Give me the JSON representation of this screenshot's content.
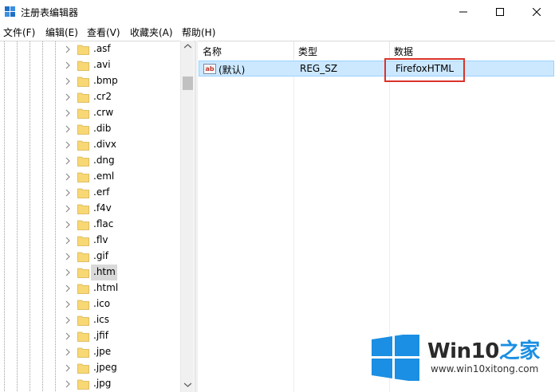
{
  "window": {
    "title": "注册表编辑器",
    "controls": {
      "minimize": "minimize",
      "maximize": "maximize",
      "close": "close"
    }
  },
  "menu": [
    "文件(F)",
    "编辑(E)",
    "查看(V)",
    "收藏夹(A)",
    "帮助(H)"
  ],
  "tree": {
    "items": [
      ".asf",
      ".avi",
      ".bmp",
      ".cr2",
      ".crw",
      ".dib",
      ".divx",
      ".dng",
      ".eml",
      ".erf",
      ".f4v",
      ".flac",
      ".flv",
      ".gif",
      ".htm",
      ".html",
      ".ico",
      ".ics",
      ".jfif",
      ".jpe",
      ".jpeg",
      ".jpg"
    ],
    "selected": ".htm"
  },
  "list": {
    "columns": [
      "名称",
      "类型",
      "数据"
    ],
    "rows": [
      {
        "icon": "string-value-icon",
        "icon_text": "ab",
        "name": "(默认)",
        "type": "REG_SZ",
        "data": "FirefoxHTML"
      }
    ]
  },
  "watermark": {
    "title_main": "Win10",
    "title_accent": "之家",
    "url": "www.win10xitong.com"
  },
  "colors": {
    "selection": "#cce8ff",
    "highlight_box": "#d9332b",
    "folder": "#f8d775",
    "watermark_blue": "#1a8fe3"
  }
}
